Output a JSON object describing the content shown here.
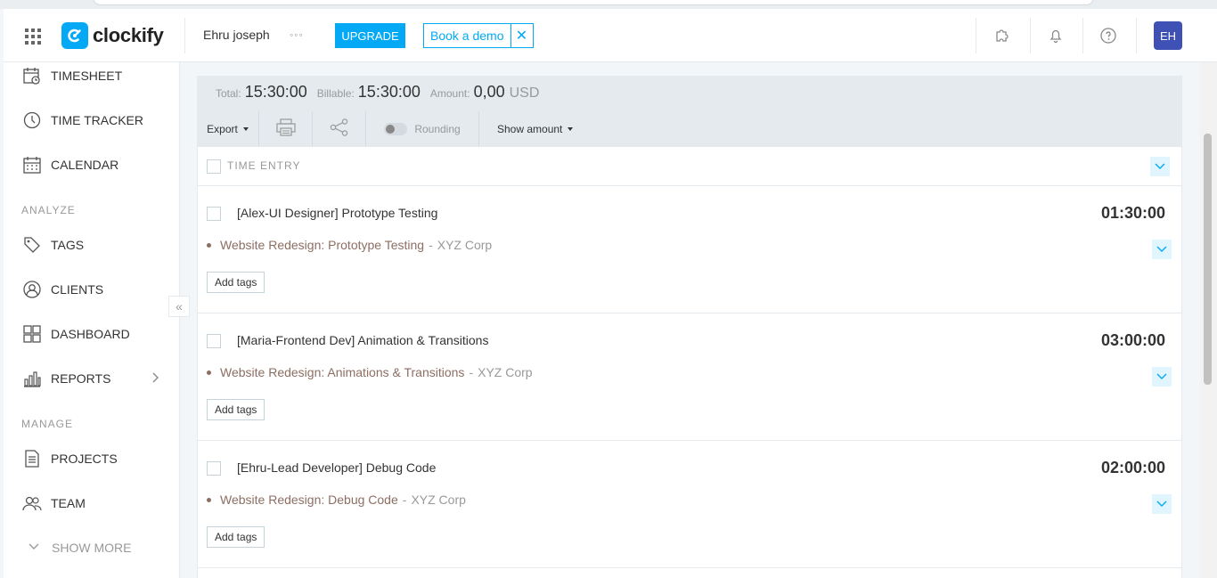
{
  "header": {
    "app_name": "clockify",
    "workspace": "Ehru joseph",
    "more_label": "◦◦◦",
    "upgrade_label": "UPGRADE",
    "demo_label": "Book a demo",
    "demo_close": "✕",
    "avatar_initials": "EH",
    "icons": [
      "grid-icon",
      "puzzle-icon",
      "bell-icon",
      "help-icon"
    ]
  },
  "sidebar": {
    "items_top": [
      {
        "label": "TIMESHEET",
        "icon": "timesheet-icon"
      },
      {
        "label": "TIME TRACKER",
        "icon": "clock-icon"
      },
      {
        "label": "CALENDAR",
        "icon": "calendar-icon"
      }
    ],
    "analyze_title": "ANALYZE",
    "items_analyze": [
      {
        "label": "TAGS",
        "icon": "tag-icon"
      },
      {
        "label": "CLIENTS",
        "icon": "clients-icon"
      },
      {
        "label": "DASHBOARD",
        "icon": "dashboard-icon"
      },
      {
        "label": "REPORTS",
        "icon": "reports-icon"
      }
    ],
    "manage_title": "MANAGE",
    "items_manage": [
      {
        "label": "PROJECTS",
        "icon": "projects-icon"
      },
      {
        "label": "TEAM",
        "icon": "team-icon"
      }
    ],
    "show_more": "SHOW MORE",
    "collapse_glyph": "«"
  },
  "summary": {
    "total_label": "Total:",
    "total_value": "15:30:00",
    "billable_label": "Billable:",
    "billable_value": "15:30:00",
    "amount_label": "Amount:",
    "amount_value": "0,00",
    "amount_currency": "USD"
  },
  "toolbar": {
    "export_label": "Export",
    "rounding_label": "Rounding",
    "show_amount_label": "Show amount",
    "rounding_on": false
  },
  "entries_header": {
    "label": "TIME ENTRY"
  },
  "entries": [
    {
      "description": "[Alex-UI Designer] Prototype Testing",
      "duration": "01:30:00",
      "project": "Website Redesign: Prototype Testing",
      "separator": "-",
      "client": "XYZ Corp",
      "add_tags": "Add tags"
    },
    {
      "description": "[Maria-Frontend Dev] Animation & Transitions",
      "duration": "03:00:00",
      "project": "Website Redesign: Animations & Transitions",
      "separator": "-",
      "client": "XYZ Corp",
      "add_tags": "Add tags"
    },
    {
      "description": "[Ehru-Lead Developer] Debug Code",
      "duration": "02:00:00",
      "project": "Website Redesign: Debug Code",
      "separator": "-",
      "client": "XYZ Corp",
      "add_tags": "Add tags"
    }
  ],
  "colors": {
    "accent": "#03a9f4",
    "avatar_bg": "#3f51b5",
    "project_color": "#8d6e63"
  }
}
